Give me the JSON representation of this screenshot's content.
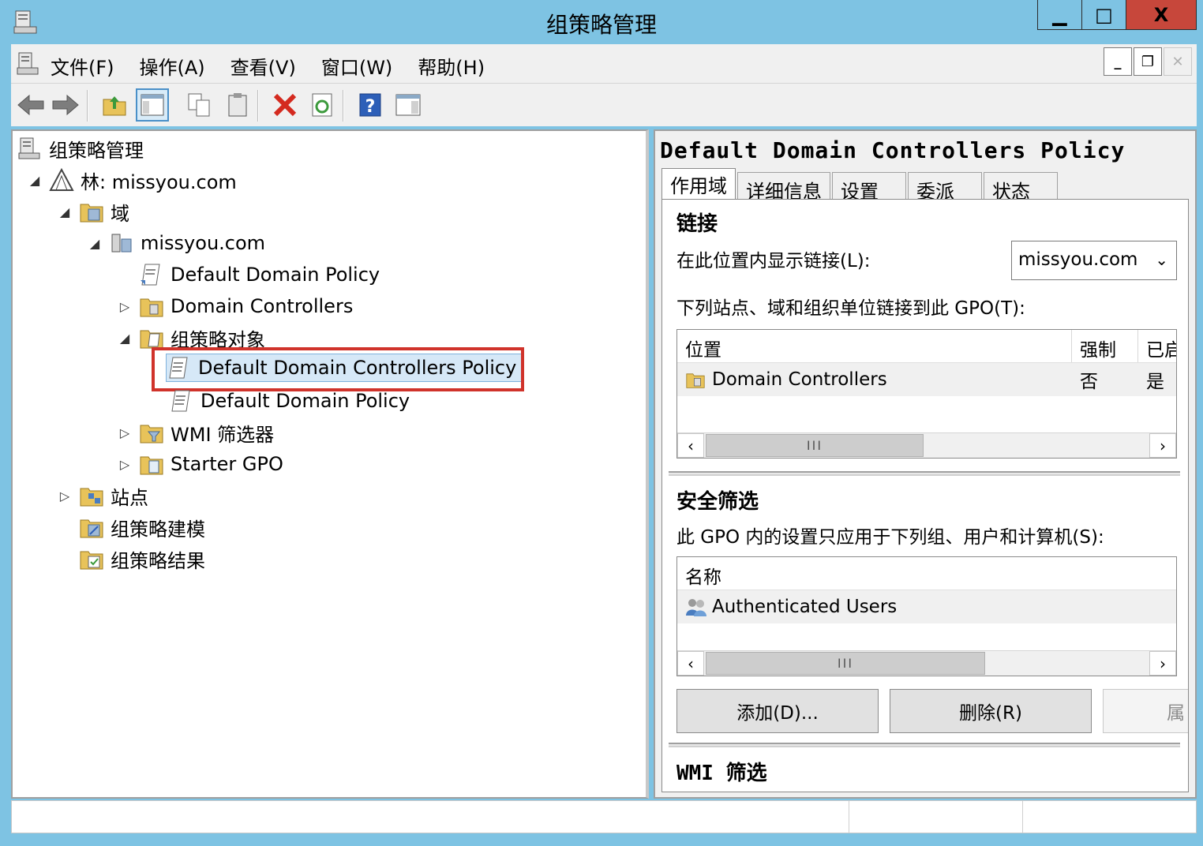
{
  "window": {
    "title": "组策略管理",
    "buttons": {
      "minimize": "▁",
      "maximize": "□",
      "close": "X"
    }
  },
  "menu": {
    "items": [
      "文件(F)",
      "操作(A)",
      "查看(V)",
      "窗口(W)",
      "帮助(H)"
    ]
  },
  "tree": {
    "root": "组策略管理",
    "forest": "林: missyou.com",
    "domains": "域",
    "domain": "missyou.com",
    "ddp_link": "Default Domain Policy",
    "dc_ou": "Domain Controllers",
    "gpo_container": "组策略对象",
    "gpo_ddcp": "Default Domain Controllers Policy",
    "gpo_ddp": "Default Domain Policy",
    "wmi": "WMI 筛选器",
    "starter": "Starter GPO",
    "sites": "站点",
    "modeling": "组策略建模",
    "results": "组策略结果"
  },
  "detail": {
    "title": "Default Domain Controllers Policy",
    "tabs": [
      "作用域",
      "详细信息",
      "设置",
      "委派",
      "状态"
    ],
    "links": {
      "heading": "链接",
      "show_label": "在此位置内显示链接(L):",
      "location_value": "missyou.com",
      "list_label": "下列站点、域和组织单位链接到此 GPO(T):",
      "columns": [
        "位置",
        "强制",
        "已启"
      ],
      "rows": [
        {
          "location": "Domain Controllers",
          "enforced": "否",
          "enabled": "是"
        }
      ],
      "scroll_thumb": "III"
    },
    "security": {
      "heading": "安全筛选",
      "desc": "此 GPO 内的设置只应用于下列组、用户和计算机(S):",
      "column": "名称",
      "rows": [
        "Authenticated Users"
      ],
      "scroll_thumb": "III",
      "add_button": "添加(D)...",
      "remove_button": "删除(R)",
      "properties_button": "属"
    },
    "wmi": {
      "heading": "WMI 筛选"
    }
  }
}
